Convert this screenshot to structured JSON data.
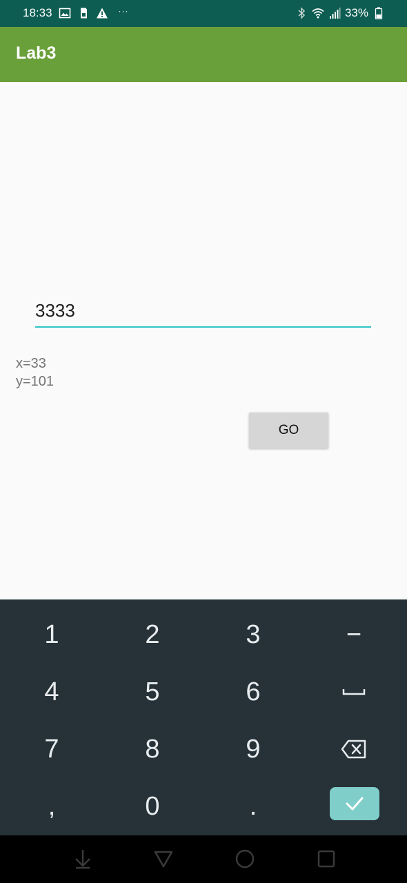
{
  "status_bar": {
    "time": "18:33",
    "dots": "···",
    "battery_percent": "33%",
    "icons": [
      "image-icon",
      "sim-icon",
      "warning-icon",
      "bluetooth-icon",
      "wifi-icon",
      "signal-icon",
      "battery-icon"
    ]
  },
  "app_bar": {
    "title": "Lab3"
  },
  "main": {
    "input_value": "3333",
    "x_text": "x=33",
    "y_text": "y=101",
    "go_label": "GO"
  },
  "keyboard": {
    "row1": [
      "1",
      "2",
      "3",
      "−"
    ],
    "row2": [
      "4",
      "5",
      "6"
    ],
    "row3": [
      "7",
      "8",
      "9"
    ],
    "row4": [
      ",",
      "0",
      "."
    ],
    "special_keys": [
      "space-icon",
      "backspace-icon",
      "check-icon"
    ]
  },
  "nav_bar": {
    "icons": [
      "hide-keyboard-icon",
      "back-icon",
      "home-icon",
      "recents-icon"
    ]
  },
  "colors": {
    "status_bar": "#0d5d52",
    "app_bar": "#6aa03a",
    "accent": "#2ec4c6",
    "keyboard_bg": "#263238",
    "enter_key": "#7fcec9"
  }
}
